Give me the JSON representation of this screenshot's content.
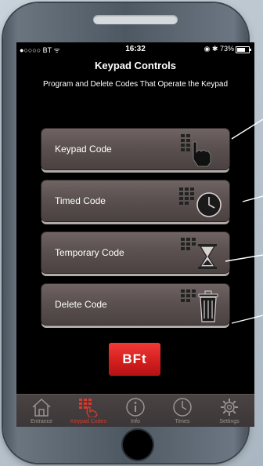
{
  "status_bar": {
    "carrier": "●○○○○ BT ᯤ",
    "time": "16:32",
    "right": "◉ ✱ 73%"
  },
  "header": {
    "title": "Keypad Controls",
    "subtitle": "Program and Delete Codes That Operate the Keypad"
  },
  "menu": {
    "keypad_code": "Keypad Code",
    "timed_code": "Timed Code",
    "temporary_code": "Temporary Code",
    "delete_code": "Delete Code"
  },
  "logo": {
    "text": "BFt"
  },
  "tabs": {
    "entrance": "Entrance",
    "keypad_codes": "Keypad Codes",
    "info": "Info",
    "times": "Times",
    "settings": "Settings"
  },
  "colors": {
    "accent": "#d93a2e",
    "button": "#5b5150",
    "logo": "#d31f1e"
  },
  "icons": {
    "keypad_code": "keypad-hand-icon",
    "timed_code": "keypad-clock-icon",
    "temporary_code": "keypad-hourglass-icon",
    "delete_code": "keypad-trash-icon"
  }
}
